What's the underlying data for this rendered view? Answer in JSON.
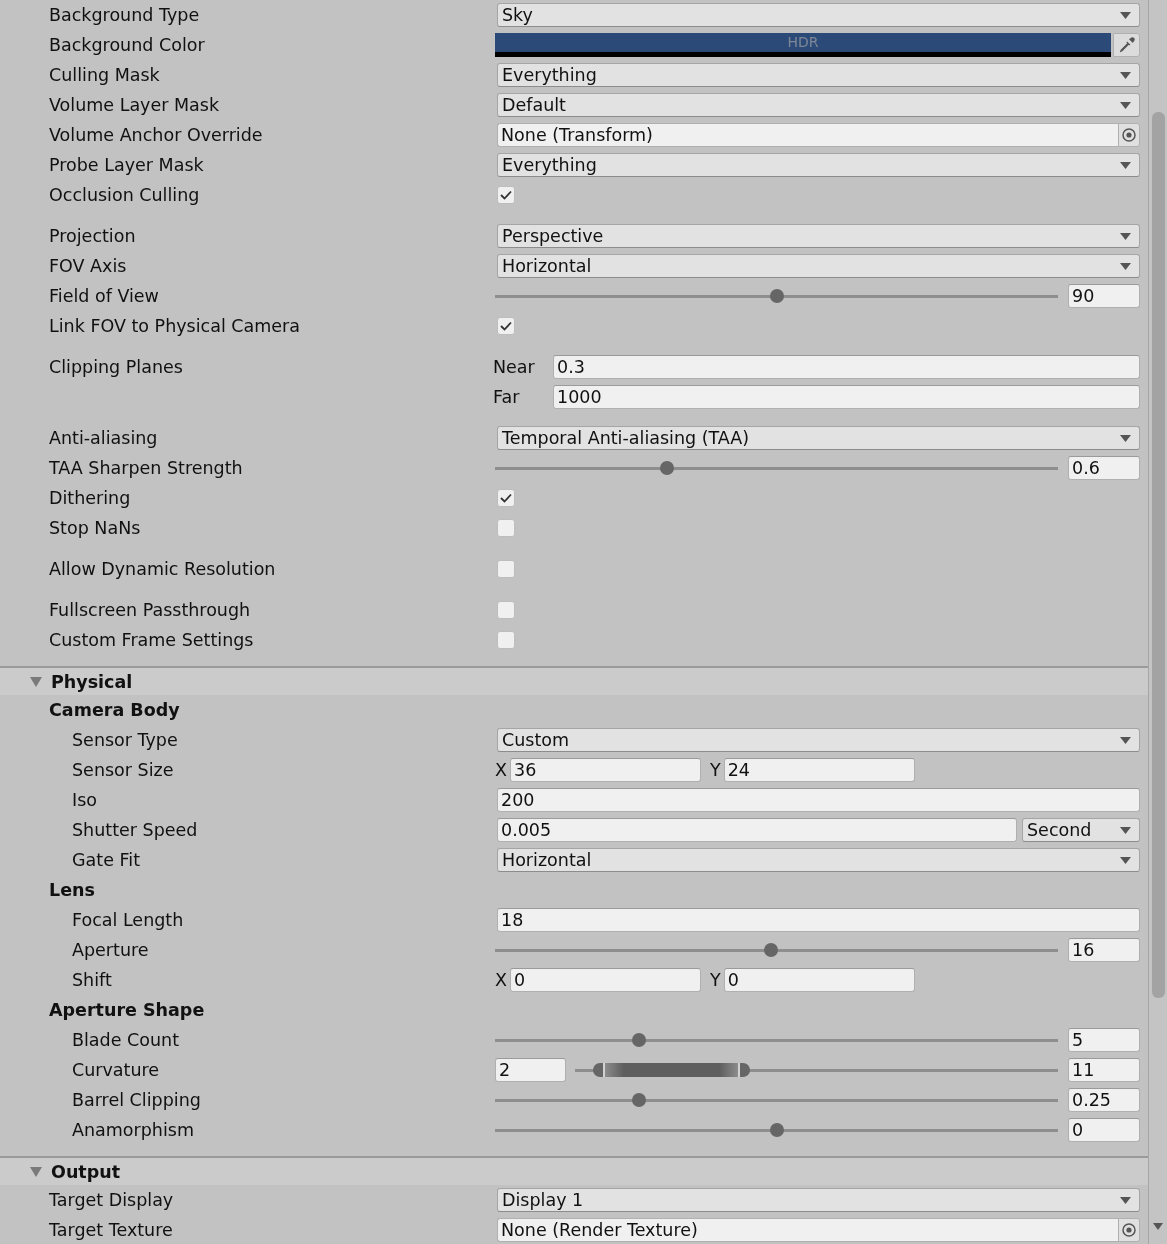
{
  "settings": {
    "groups": [
      {
        "properties": [
          {
            "label": "Background Type",
            "kind": "dropdown",
            "value": "Sky"
          },
          {
            "label": "Background Color",
            "kind": "color",
            "color": "#2b4a78",
            "badge": "HDR"
          },
          {
            "label": "Culling Mask",
            "kind": "dropdown",
            "value": "Everything"
          },
          {
            "label": "Volume Layer Mask",
            "kind": "dropdown",
            "value": "Default"
          },
          {
            "label": "Volume Anchor Override",
            "kind": "object",
            "value": "None (Transform)"
          },
          {
            "label": "Probe Layer Mask",
            "kind": "dropdown",
            "value": "Everything"
          },
          {
            "label": "Occlusion Culling",
            "kind": "checkbox",
            "checked": true
          }
        ]
      },
      {
        "properties": [
          {
            "label": "Projection",
            "kind": "dropdown",
            "value": "Perspective"
          },
          {
            "label": "FOV Axis",
            "kind": "dropdown",
            "value": "Horizontal"
          },
          {
            "label": "Field of View",
            "kind": "slider",
            "level": 0.5,
            "value": "90"
          },
          {
            "label": "Link FOV to Physical Camera",
            "kind": "checkbox",
            "checked": true
          }
        ]
      },
      {
        "properties": [
          {
            "label": "Clipping Planes",
            "kind": "planes",
            "fields": [
              {
                "label": "Near",
                "value": "0.3"
              },
              {
                "label": "Far",
                "value": "1000"
              }
            ]
          }
        ]
      },
      {
        "properties": [
          {
            "label": "Anti-aliasing",
            "kind": "dropdown",
            "value": "Temporal Anti-aliasing (TAA)"
          },
          {
            "label": "TAA Sharpen Strength",
            "kind": "slider",
            "level": 0.3,
            "value": "0.6"
          },
          {
            "label": "Dithering",
            "kind": "checkbox",
            "checked": true
          },
          {
            "label": "Stop NaNs",
            "kind": "checkbox",
            "checked": false
          }
        ]
      },
      {
        "properties": [
          {
            "label": "Allow Dynamic Resolution",
            "kind": "checkbox",
            "checked": false
          }
        ]
      },
      {
        "properties": [
          {
            "label": "Fullscreen Passthrough",
            "kind": "checkbox",
            "checked": false
          },
          {
            "label": "Custom Frame Settings",
            "kind": "checkbox",
            "checked": false
          }
        ]
      }
    ]
  },
  "sections": [
    {
      "title": "Physical",
      "expanded": true,
      "groups": [
        {
          "title": "Camera Body",
          "properties": [
            {
              "label": "Sensor Type",
              "kind": "dropdown",
              "value": "Custom"
            },
            {
              "label": "Sensor Size",
              "kind": "vector2",
              "fields": [
                {
                  "label": "X",
                  "value": "36"
                },
                {
                  "label": "Y",
                  "value": "24"
                }
              ]
            },
            {
              "label": "Iso",
              "kind": "number",
              "value": "200"
            },
            {
              "label": "Shutter Speed",
              "kind": "number_unit",
              "value": "0.005",
              "unit": "Second"
            },
            {
              "label": "Gate Fit",
              "kind": "dropdown",
              "value": "Horizontal"
            }
          ]
        },
        {
          "title": "Lens",
          "properties": [
            {
              "label": "Focal Length",
              "kind": "number",
              "value": "18"
            },
            {
              "label": "Aperture",
              "kind": "slider",
              "level": 0.49,
              "value": "16"
            },
            {
              "label": "Shift",
              "kind": "vector2",
              "fields": [
                {
                  "label": "X",
                  "value": "0"
                },
                {
                  "label": "Y",
                  "value": "0"
                }
              ]
            }
          ]
        },
        {
          "title": "Aperture Shape",
          "properties": [
            {
              "label": "Blade Count",
              "kind": "slider",
              "level": 0.25,
              "value": "5"
            },
            {
              "label": "Curvature",
              "kind": "range",
              "min": "2",
              "max": "11",
              "handles": [
                {
                  "level": 0.04
                },
                {
                  "level": 0.33
                }
              ]
            },
            {
              "label": "Barrel Clipping",
              "kind": "slider",
              "level": 0.25,
              "value": "0.25"
            },
            {
              "label": "Anamorphism",
              "kind": "slider",
              "level": 0.5,
              "value": "0"
            }
          ]
        }
      ]
    },
    {
      "title": "Output",
      "expanded": true,
      "groups": [
        {
          "properties": [
            {
              "label": "Target Display",
              "kind": "dropdown",
              "value": "Display 1"
            },
            {
              "label": "Target Texture",
              "kind": "object",
              "value": "None (Render Texture)"
            }
          ]
        }
      ]
    }
  ]
}
